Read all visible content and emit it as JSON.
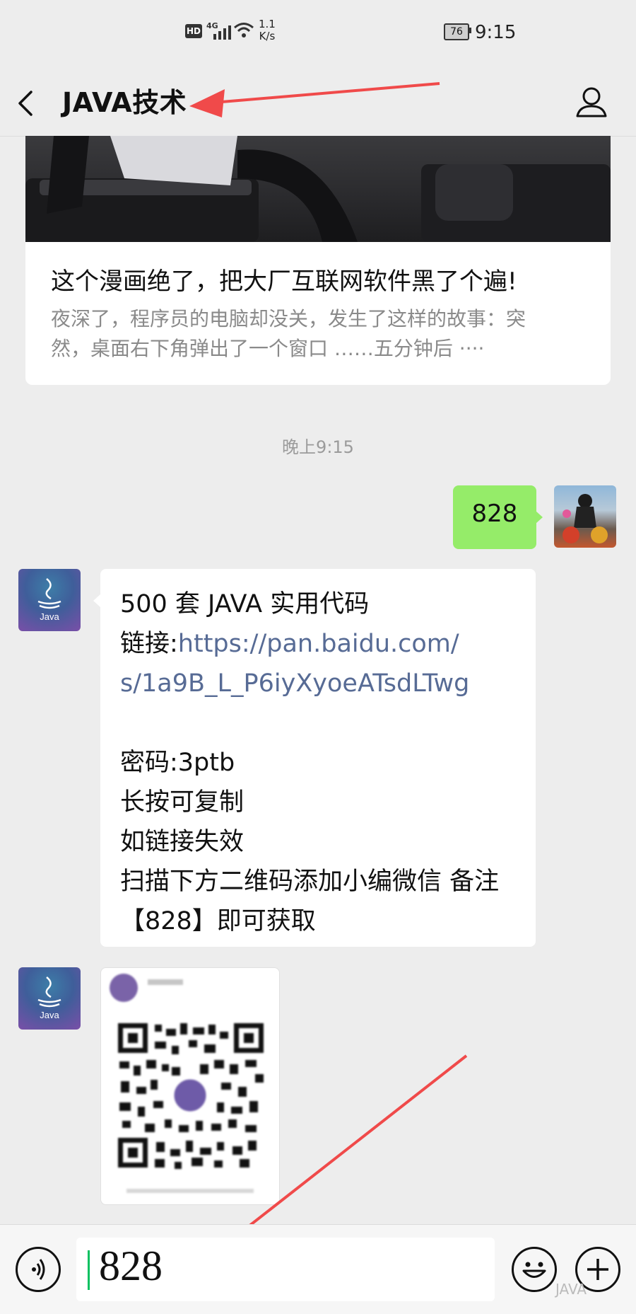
{
  "status_bar": {
    "network_speed": "1.1",
    "network_unit": "K/s",
    "battery": "76",
    "time": "9:15",
    "hd_badge": "HD",
    "signal_label": "4G"
  },
  "header": {
    "title": "JAVA技术",
    "back_icon": "chevron-left-icon",
    "profile_icon": "user-icon"
  },
  "article": {
    "title": "这个漫画绝了，把大厂互联网软件黑了个遍!",
    "desc_line1": "夜深了，程序员的电脑却没关，发生了这样的故事：突",
    "desc_line2": "然，桌面右下角弹出了一个窗口 ……五分钟后 ····"
  },
  "timestamp": "晚上9:15",
  "outgoing_message": "828",
  "incoming_message": {
    "line1": "500 套 JAVA 实用代码",
    "link_prefix": "链接:",
    "link_line1": "https://pan.baidu.com/",
    "link_line2": "s/1a9B_L_P6iyXyoeATsdLTwg",
    "password": "密码:3ptb",
    "copy_hint": "长按可复制",
    "fail_hint": "如链接失效",
    "scan_hint": "扫描下方二维码添加小编微信 备注",
    "get_hint": "【828】即可获取"
  },
  "avatar_label": "Java",
  "input": {
    "value": "828",
    "voice_icon": "voice-icon",
    "emoji_icon": "emoji-icon",
    "plus_icon": "plus-icon"
  },
  "watermark": "JAVA",
  "colors": {
    "outgoing_bubble": "#95ec69",
    "link": "#576b95",
    "annotation_arrow": "#f04a4a"
  }
}
